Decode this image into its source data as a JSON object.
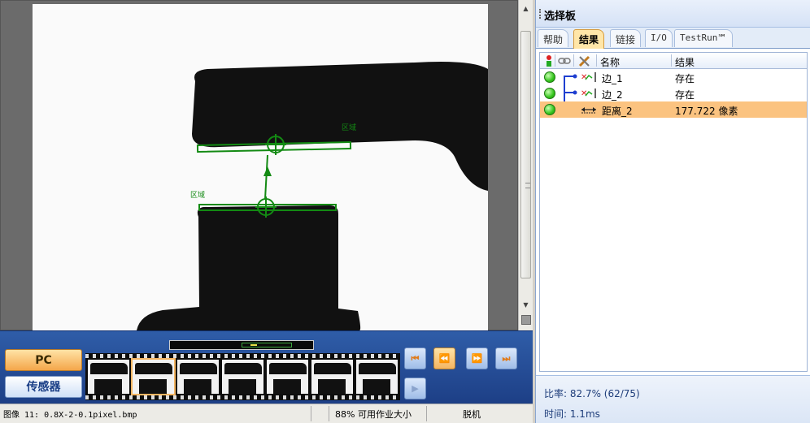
{
  "viewer": {
    "region_label_top": "区域",
    "region_label_bottom": "区域"
  },
  "film": {
    "pc_label": "PC",
    "sensor_label": "传感器",
    "nav": [
      "⏮",
      "⏪",
      "⏩",
      "⏭",
      "▶"
    ]
  },
  "status": {
    "image_info": "图像 11: 0.8X-2-0.1pixel.bmp",
    "workspace": "88% 可用作业大小",
    "mode": "脱机"
  },
  "panel": {
    "title": "选择板",
    "tabs": [
      "帮助",
      "结果",
      "链接",
      "I/O",
      "TestRun℠"
    ],
    "selected_tab": "结果",
    "columns": {
      "name": "名称",
      "result": "结果"
    },
    "rows": [
      {
        "name": "边_1",
        "result": "存在",
        "icon": "edge-icon",
        "status": "pass"
      },
      {
        "name": "边_2",
        "result": "存在",
        "icon": "edge-icon",
        "status": "pass"
      },
      {
        "name": "距离_2",
        "result": "177.722 像素",
        "icon": "distance-icon",
        "status": "pass",
        "selected": true
      }
    ],
    "ratio": "比率:  82.7% (62/75)",
    "time": "时间:  1.1ms"
  },
  "colors": {
    "overlay_green": "#138a13",
    "selected_row": "#fbc380",
    "film_blue": "#2f5da8"
  }
}
